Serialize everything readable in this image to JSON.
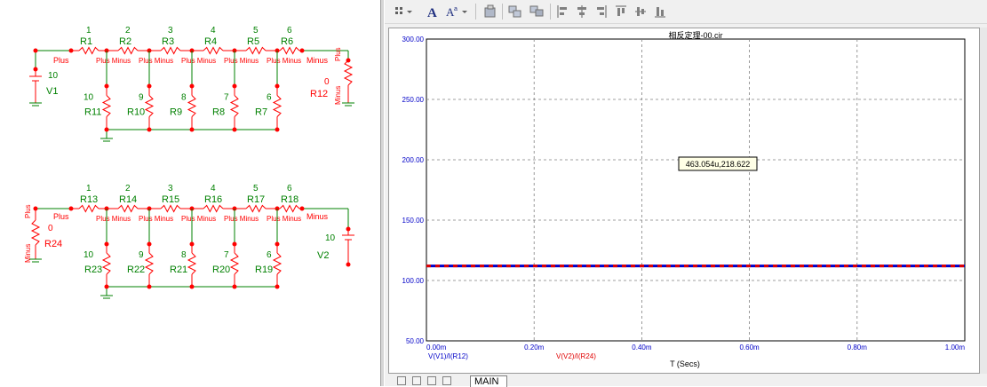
{
  "plot": {
    "title": "相反定理-00.cir",
    "x_axis_label": "T (Secs)",
    "y_ticks": [
      "300.00",
      "250.00",
      "200.00",
      "150.00",
      "100.00",
      "50.00"
    ],
    "x_ticks": [
      "0.00m",
      "0.20m",
      "0.40m",
      "0.60m",
      "0.80m",
      "1.00m"
    ],
    "cursor_readout": "463.054u,218.622",
    "traces": [
      {
        "label": "V(V1)/I(R12)",
        "color": "#0000c8"
      },
      {
        "label": "V(V2)/I(R24)",
        "color": "#e00000"
      }
    ]
  },
  "chart_data": {
    "type": "line",
    "title": "相反定理-00.cir",
    "xlabel": "T (Secs)",
    "ylabel": "",
    "x": [
      0,
      1.0
    ],
    "xlim": [
      0,
      1.0
    ],
    "ylim": [
      50,
      300
    ],
    "grid": true,
    "series": [
      {
        "name": "V(V1)/I(R12)",
        "values": [
          112,
          112
        ],
        "color": "#0000c8"
      },
      {
        "name": "V(V2)/I(R24)",
        "values": [
          112,
          112
        ],
        "color": "#e00000"
      }
    ]
  },
  "tabs": {
    "active": "MAIN"
  },
  "schematic": {
    "top_nodes": [
      "1",
      "2",
      "3",
      "4",
      "5",
      "6"
    ],
    "top_series": [
      "R1",
      "R2",
      "R3",
      "R4",
      "R5",
      "R6"
    ],
    "top_shunt": [
      {
        "name": "R11",
        "value": "10"
      },
      {
        "name": "R10",
        "value": "9"
      },
      {
        "name": "R9",
        "value": "8"
      },
      {
        "name": "R8",
        "value": "7"
      },
      {
        "name": "R7",
        "value": "6"
      }
    ],
    "bottom_nodes": [
      "1",
      "2",
      "3",
      "4",
      "5",
      "6"
    ],
    "bottom_series": [
      "R13",
      "R14",
      "R15",
      "R16",
      "R17",
      "R18"
    ],
    "bottom_shunt": [
      {
        "name": "R23",
        "value": "10"
      },
      {
        "name": "R22",
        "value": "9"
      },
      {
        "name": "R21",
        "value": "8"
      },
      {
        "name": "R20",
        "value": "7"
      },
      {
        "name": "R19",
        "value": "6"
      }
    ],
    "top_source": {
      "name": "V1",
      "value": "10"
    },
    "top_load": {
      "name": "R12",
      "value": "0"
    },
    "bottom_source": {
      "name": "V2",
      "value": "10"
    },
    "bottom_load": {
      "name": "R24",
      "value": "0"
    },
    "pin_plus": "Plus",
    "pin_minus": "Minus",
    "pin_plus_minus": "Plus Minus"
  }
}
